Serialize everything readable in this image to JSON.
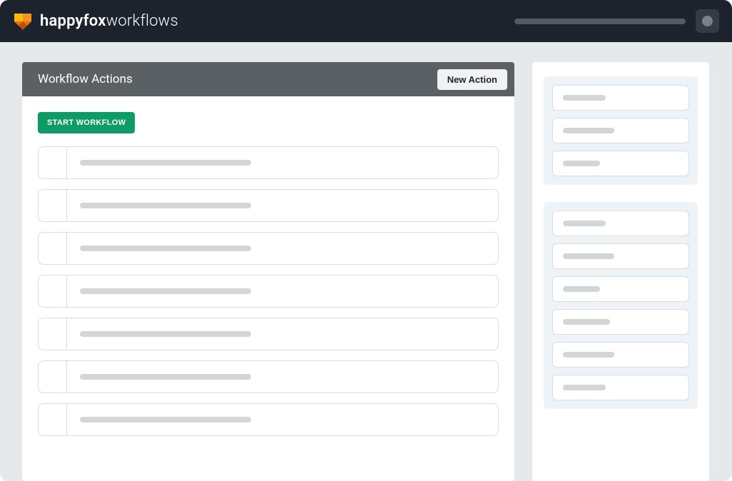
{
  "brand": {
    "name_bold": "happyfox",
    "name_light": "workflows"
  },
  "panel": {
    "title": "Workflow Actions",
    "new_action_label": "New Action",
    "start_label": "START WORKFLOW"
  },
  "actions": [
    {
      "skeleton_width": 240
    },
    {
      "skeleton_width": 240
    },
    {
      "skeleton_width": 240
    },
    {
      "skeleton_width": 240
    },
    {
      "skeleton_width": 240
    },
    {
      "skeleton_width": 240
    },
    {
      "skeleton_width": 240
    }
  ],
  "sidebar": {
    "groups": [
      {
        "items": [
          {
            "w": 60
          },
          {
            "w": 72
          },
          {
            "w": 52
          }
        ]
      },
      {
        "items": [
          {
            "w": 60
          },
          {
            "w": 72
          },
          {
            "w": 52
          },
          {
            "w": 66
          },
          {
            "w": 72
          },
          {
            "w": 60
          }
        ]
      }
    ]
  }
}
